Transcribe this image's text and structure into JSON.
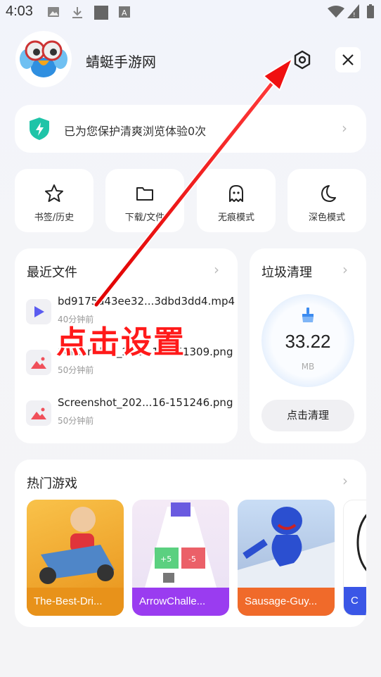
{
  "status": {
    "time": "4:03"
  },
  "header": {
    "title": "蜻蜓手游网"
  },
  "protect": {
    "text": "已为您保护清爽浏览体验0次"
  },
  "tiles": [
    {
      "label": "书签/历史",
      "icon": "star-icon"
    },
    {
      "label": "下载/文件",
      "icon": "folder-icon"
    },
    {
      "label": "无痕模式",
      "icon": "ghost-icon"
    },
    {
      "label": "深色模式",
      "icon": "moon-icon"
    }
  ],
  "recent": {
    "title": "最近文件",
    "files": [
      {
        "name": "bd9175a43ee32...3dbd3dd4.mp4",
        "time": "40分钟前",
        "icon": "video-play-icon"
      },
      {
        "name": "Screenshot_202...16-151309.png",
        "time": "50分钟前",
        "icon": "image-icon"
      },
      {
        "name": "Screenshot_202...16-151246.png",
        "time": "50分钟前",
        "icon": "image-icon"
      }
    ]
  },
  "junk": {
    "title": "垃圾清理",
    "value": "33.22",
    "unit": "MB",
    "button": "点击清理"
  },
  "games": {
    "title": "热门游戏",
    "items": [
      {
        "name": "The-Best-Dri...",
        "color": "#f2a41c"
      },
      {
        "name": "ArrowChalle...",
        "color": "#9a3cf0"
      },
      {
        "name": "Sausage-Guy...",
        "color": "#f06a2a"
      },
      {
        "name": "C",
        "color": "#3a56e6"
      }
    ]
  },
  "annotation": {
    "text": "点击设置"
  },
  "colors": {
    "accent": "#3d6cf0",
    "annotation": "#ff1a1a",
    "shield": "#1fc4a8"
  }
}
